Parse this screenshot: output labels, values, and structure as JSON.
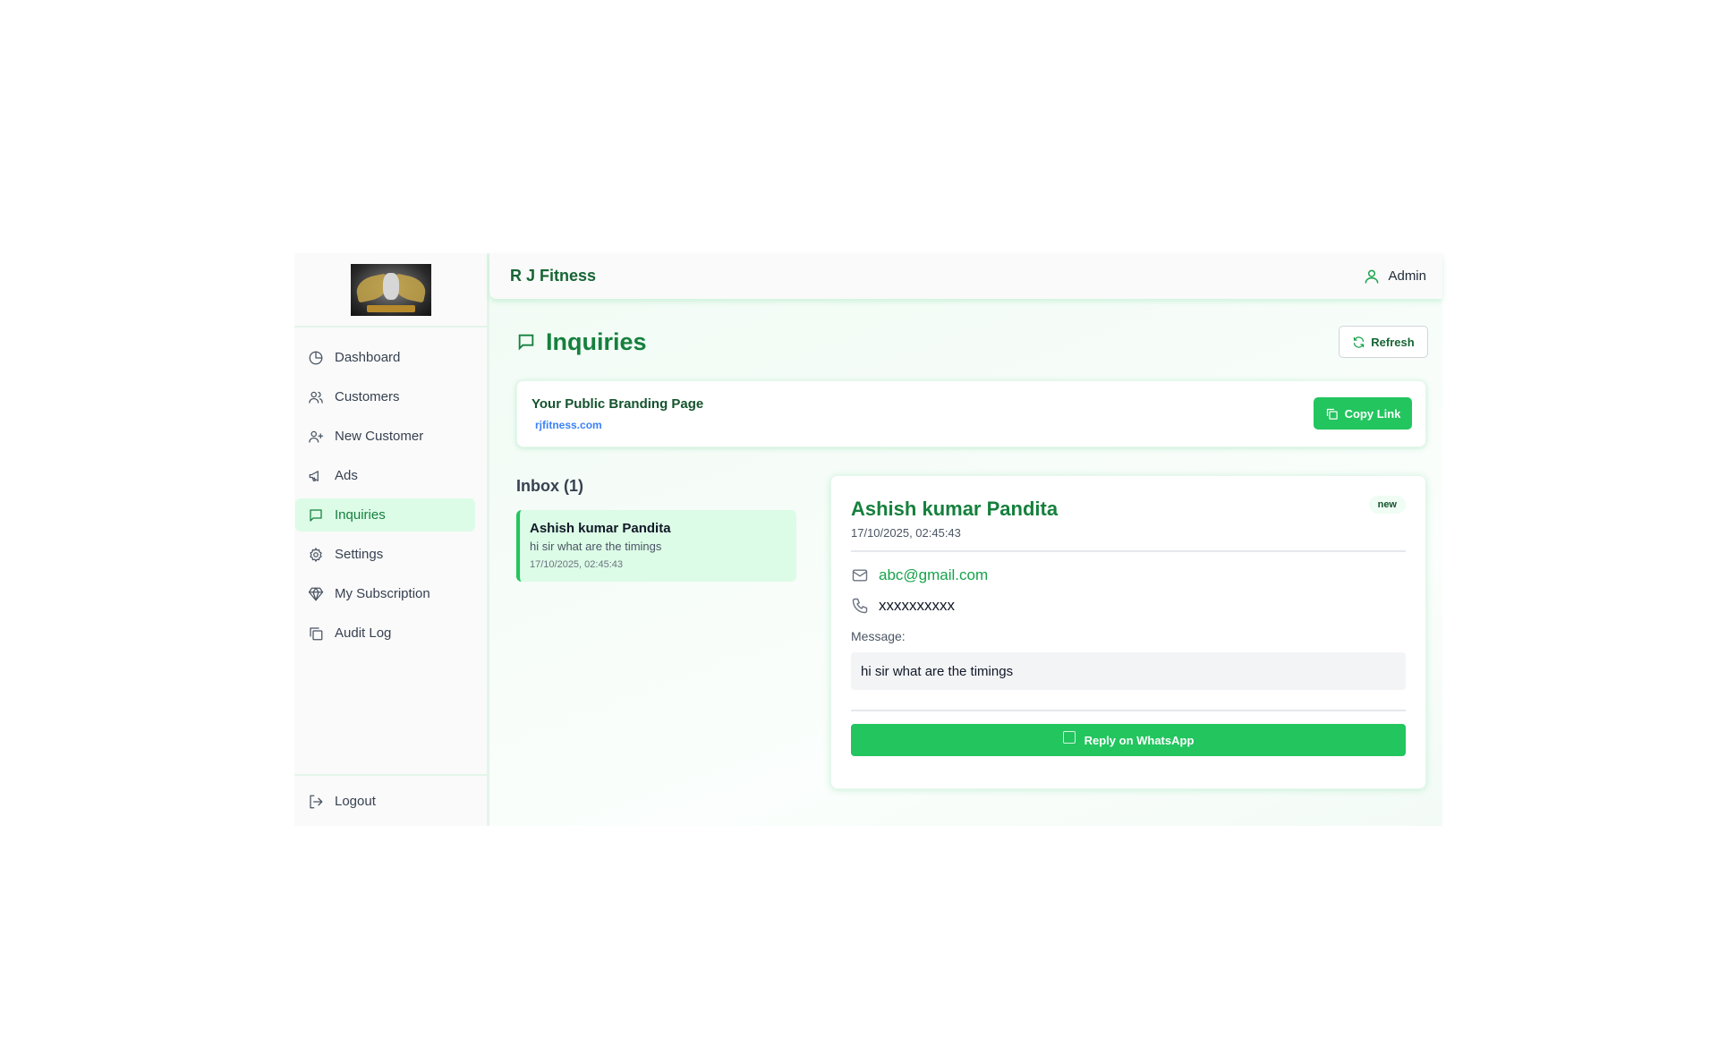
{
  "sidebar": {
    "items": [
      {
        "label": "Dashboard",
        "icon": "pie-chart-icon"
      },
      {
        "label": "Customers",
        "icon": "users-icon"
      },
      {
        "label": "New Customer",
        "icon": "user-plus-icon"
      },
      {
        "label": "Ads",
        "icon": "megaphone-icon"
      },
      {
        "label": "Inquiries",
        "icon": "message-icon",
        "active": true
      },
      {
        "label": "Settings",
        "icon": "gear-icon"
      },
      {
        "label": "My Subscription",
        "icon": "diamond-icon"
      },
      {
        "label": "Audit Log",
        "icon": "copy-icon"
      }
    ],
    "logout_label": "Logout"
  },
  "header": {
    "brand": "R J Fitness",
    "user_label": "Admin"
  },
  "page": {
    "title": "Inquiries",
    "refresh_label": "Refresh"
  },
  "branding": {
    "title": "Your Public Branding Page",
    "link": "rjfitness.com",
    "copy_label": "Copy Link"
  },
  "inbox": {
    "heading": "Inbox (1)",
    "items": [
      {
        "name": "Ashish kumar Pandita",
        "message": "hi sir what are the timings",
        "date": "17/10/2025, 02:45:43"
      }
    ]
  },
  "detail": {
    "name": "Ashish kumar Pandita",
    "date": "17/10/2025, 02:45:43",
    "status": "new",
    "email": "abc@gmail.com",
    "phone": "xxxxxxxxxx",
    "message_label": "Message:",
    "message": "hi sir what are the timings",
    "reply_label": "Reply on WhatsApp"
  },
  "colors": {
    "accent": "#22c55e",
    "accent_dark": "#15803d",
    "active_bg": "#dcfce7",
    "link": "#3b82f6"
  }
}
